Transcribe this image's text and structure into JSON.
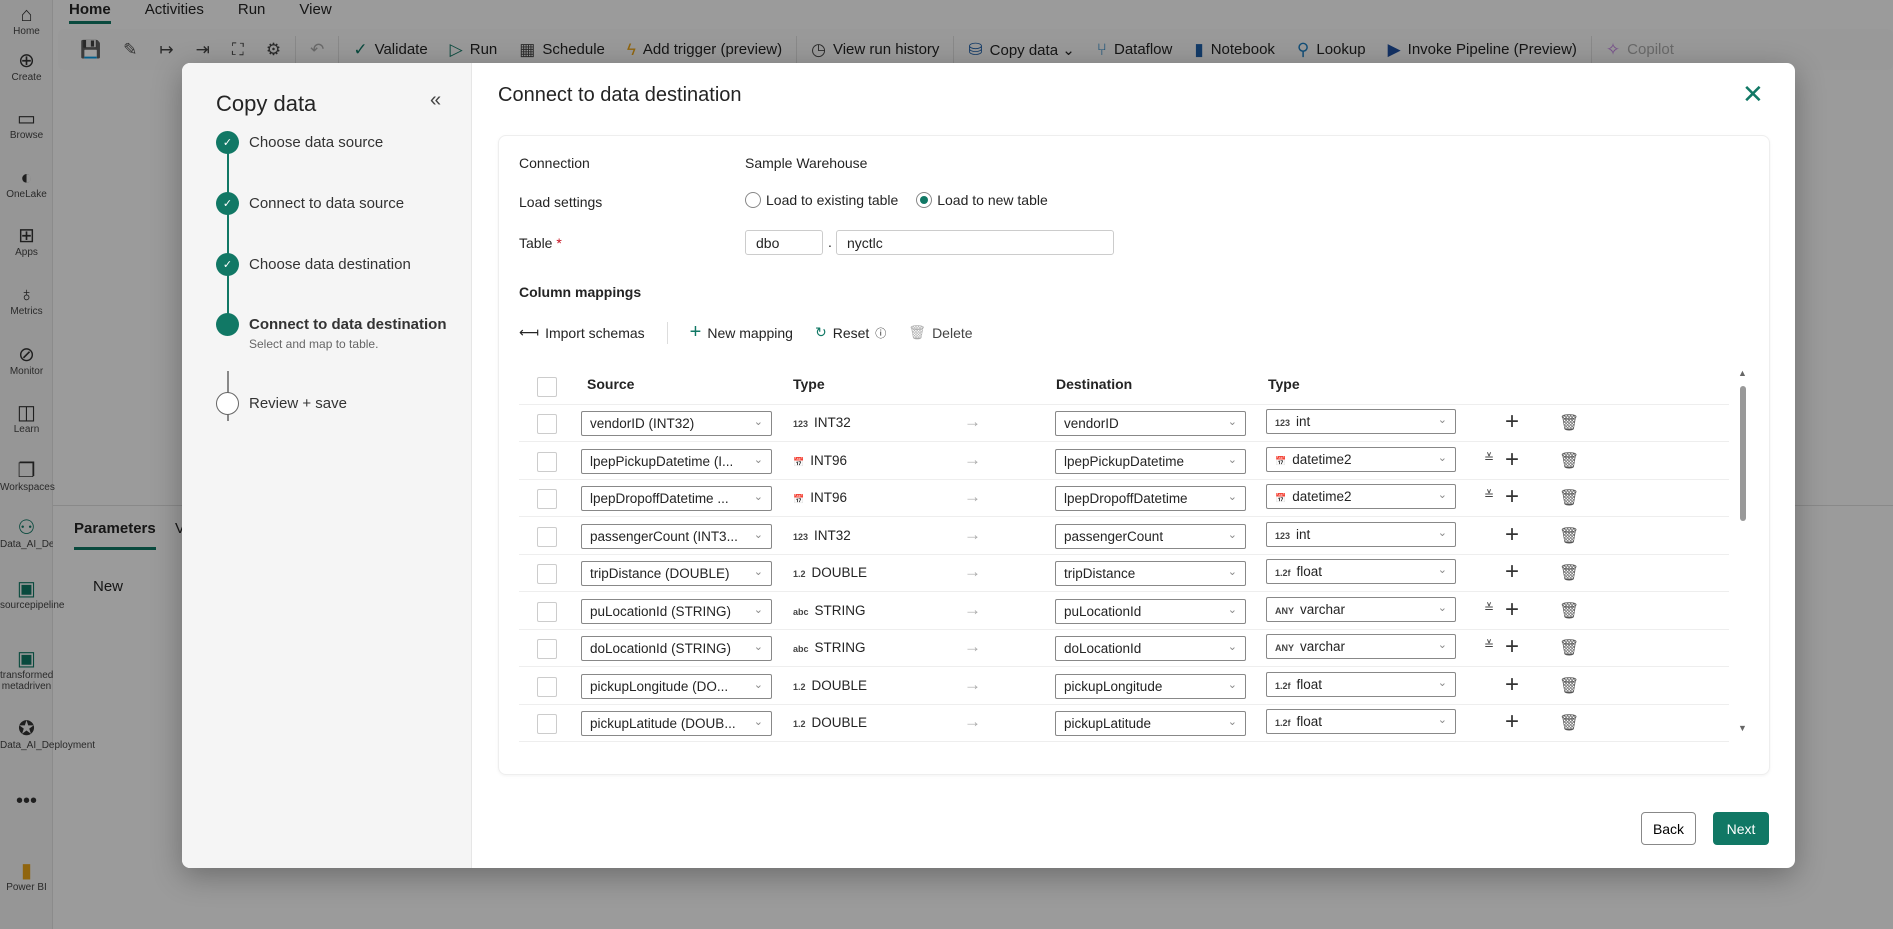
{
  "rail": [
    {
      "icon": "home-icon",
      "glyph": "⌂",
      "label": "Home"
    },
    {
      "icon": "create-icon",
      "glyph": "⊕",
      "label": "Create"
    },
    {
      "icon": "browse-icon",
      "glyph": "▭",
      "label": "Browse"
    },
    {
      "icon": "onelake-icon",
      "glyph": "◐",
      "label": "OneLake"
    },
    {
      "icon": "apps-icon",
      "glyph": "⊞",
      "label": "Apps"
    },
    {
      "icon": "metrics-icon",
      "glyph": "♁",
      "label": "Metrics"
    },
    {
      "icon": "monitor-icon",
      "glyph": "⊘",
      "label": "Monitor"
    },
    {
      "icon": "learn-icon",
      "glyph": "◫",
      "label": "Learn"
    },
    {
      "icon": "workspaces-icon",
      "glyph": "❐",
      "label": "Workspaces"
    },
    {
      "icon": "workspace-icon",
      "glyph": "⚇",
      "label": "Data_AI_Dev"
    },
    {
      "icon": "pipeline-icon",
      "glyph": "▣",
      "label": "sourcepipeline"
    },
    {
      "icon": "pipeline-icon",
      "glyph": "▣",
      "label": "transformed metadriven"
    },
    {
      "icon": "deployment-icon",
      "glyph": "✪",
      "label": "Data_AI_Deployment"
    },
    {
      "icon": "more-icon",
      "glyph": "•••",
      "label": ""
    },
    {
      "icon": "powerbi-icon",
      "glyph": "▮",
      "label": "Power BI"
    }
  ],
  "tabs": [
    "Home",
    "Activities",
    "Run",
    "View"
  ],
  "toolbar": [
    {
      "icon": "save-icon",
      "glyph": "💾",
      "label": ""
    },
    {
      "icon": "edit-icon",
      "glyph": "✎",
      "label": ""
    },
    {
      "icon": "indent-icon",
      "glyph": "↦",
      "label": ""
    },
    {
      "icon": "outdent-icon",
      "glyph": "⇥",
      "label": ""
    },
    {
      "icon": "fit-icon",
      "glyph": "⛶",
      "label": ""
    },
    {
      "icon": "gear-icon",
      "glyph": "⚙",
      "label": ""
    },
    {
      "icon": "undo-icon",
      "glyph": "↶",
      "label": ""
    },
    {
      "icon": "check-icon",
      "glyph": "✓",
      "label": "Validate"
    },
    {
      "icon": "play-icon",
      "glyph": "▷",
      "label": "Run"
    },
    {
      "icon": "calendar-icon",
      "glyph": "▦",
      "label": "Schedule"
    },
    {
      "icon": "lightning-icon",
      "glyph": "ϟ",
      "label": "Add trigger (preview)"
    },
    {
      "icon": "history-icon",
      "glyph": "◷",
      "label": "View run history"
    },
    {
      "icon": "copy-data-icon",
      "glyph": "⛁",
      "label": "Copy data ⌄"
    },
    {
      "icon": "dataflow-icon",
      "glyph": "⑂",
      "label": "Dataflow"
    },
    {
      "icon": "notebook-icon",
      "glyph": "▮",
      "label": "Notebook"
    },
    {
      "icon": "lookup-icon",
      "glyph": "⚲",
      "label": "Lookup"
    },
    {
      "icon": "invoke-pipeline-icon",
      "glyph": "▶",
      "label": "Invoke Pipeline (Preview)"
    },
    {
      "icon": "copilot-icon",
      "glyph": "✧",
      "label": "Copilot"
    }
  ],
  "bottom": {
    "tab": "Parameters",
    "tab2": "V",
    "new": "New"
  },
  "wizard": {
    "title": "Copy data",
    "steps": [
      {
        "label": "Choose data source",
        "state": "done"
      },
      {
        "label": "Connect to data source",
        "state": "done"
      },
      {
        "label": "Choose data destination",
        "state": "done"
      },
      {
        "label": "Connect to data destination",
        "state": "current",
        "sub": "Select and map to table."
      },
      {
        "label": "Review + save",
        "state": "pending"
      }
    ]
  },
  "main": {
    "title": "Connect to data destination",
    "connection_label": "Connection",
    "connection_value": "Sample Warehouse",
    "load_label": "Load settings",
    "load_options": [
      "Load to existing table",
      "Load to new table"
    ],
    "load_selected": "Load to new table",
    "table_label": "Table",
    "required": "*",
    "schema": "dbo",
    "dot": ".",
    "table": "nyctlc",
    "mappings_label": "Column mappings",
    "actions": {
      "import": "Import schemas",
      "new": "New mapping",
      "reset": "Reset",
      "delete": "Delete"
    },
    "headers": {
      "source": "Source",
      "type": "Type",
      "destination": "Destination",
      "dtype": "Type"
    },
    "rows": [
      {
        "source": "vendorID (INT32)",
        "ticon": "123",
        "type": "INT32",
        "dest": "vendorID",
        "dicon": "123",
        "dtype": "int",
        "expand": false
      },
      {
        "source": "lpepPickupDatetime (I...",
        "ticon": "📅",
        "type": "INT96",
        "dest": "lpepPickupDatetime",
        "dicon": "📅",
        "dtype": "datetime2",
        "expand": true
      },
      {
        "source": "lpepDropoffDatetime ...",
        "ticon": "📅",
        "type": "INT96",
        "dest": "lpepDropoffDatetime",
        "dicon": "📅",
        "dtype": "datetime2",
        "expand": true
      },
      {
        "source": "passengerCount (INT3...",
        "ticon": "123",
        "type": "INT32",
        "dest": "passengerCount",
        "dicon": "123",
        "dtype": "int",
        "expand": false
      },
      {
        "source": "tripDistance (DOUBLE)",
        "ticon": "1.2",
        "type": "DOUBLE",
        "dest": "tripDistance",
        "dicon": "1.2f",
        "dtype": "float",
        "expand": false
      },
      {
        "source": "puLocationId (STRING)",
        "ticon": "abc",
        "type": "STRING",
        "dest": "puLocationId",
        "dicon": "ANY",
        "dtype": "varchar",
        "expand": true
      },
      {
        "source": "doLocationId (STRING)",
        "ticon": "abc",
        "type": "STRING",
        "dest": "doLocationId",
        "dicon": "ANY",
        "dtype": "varchar",
        "expand": true
      },
      {
        "source": "pickupLongitude (DO...",
        "ticon": "1.2",
        "type": "DOUBLE",
        "dest": "pickupLongitude",
        "dicon": "1.2f",
        "dtype": "float",
        "expand": false
      },
      {
        "source": "pickupLatitude (DOUB...",
        "ticon": "1.2",
        "type": "DOUBLE",
        "dest": "pickupLatitude",
        "dicon": "1.2f",
        "dtype": "float",
        "expand": false
      }
    ],
    "back": "Back",
    "next": "Next"
  },
  "colors": {
    "accent": "#117865"
  }
}
